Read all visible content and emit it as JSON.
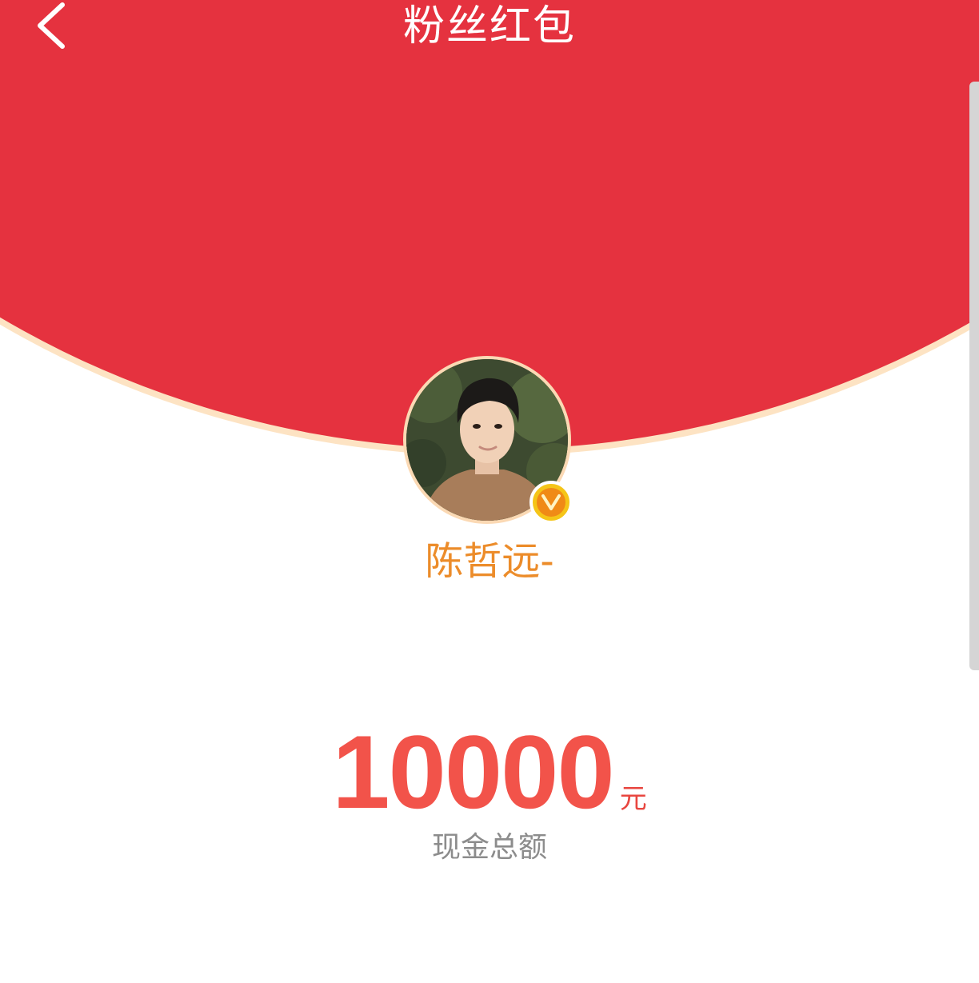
{
  "header": {
    "title": "粉丝红包"
  },
  "sender": {
    "name": "陈哲远-",
    "verified": true
  },
  "amount": {
    "value": "10000",
    "unit": "元",
    "label": "现金总额"
  },
  "colors": {
    "envelope_red": "#e5323f",
    "rim_peach": "#fde3c3",
    "name_orange": "#ec8c2a",
    "amount_red": "#f2534a",
    "label_gray": "#8c8c8c",
    "badge_gold": "#f5c518"
  },
  "icons": {
    "back": "chevron-left-icon",
    "verified": "verified-v-icon"
  }
}
